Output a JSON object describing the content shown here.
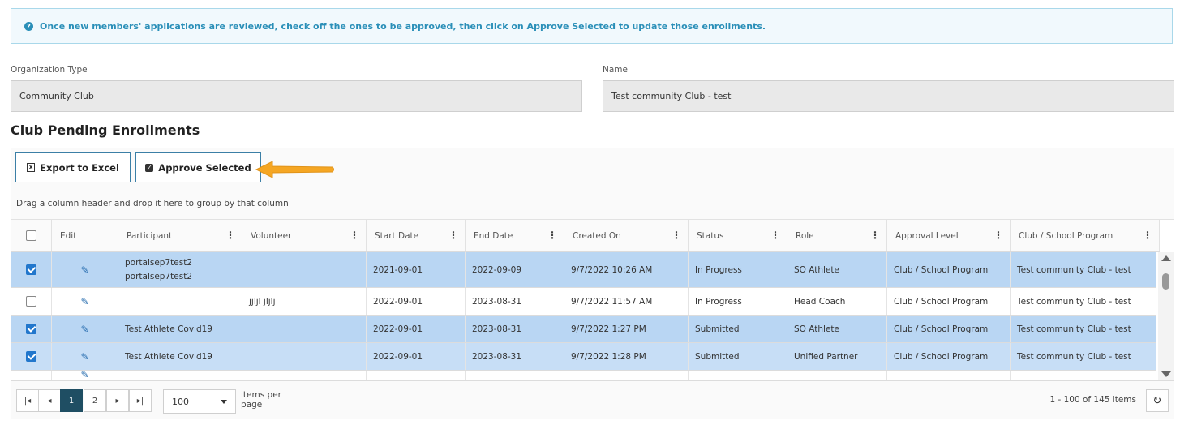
{
  "info": {
    "message": "Once new members' applications are reviewed, check off the ones to be approved, then click on Approve Selected to update those enrollments."
  },
  "fields": {
    "org_type_label": "Organization Type",
    "org_type_value": "Community Club",
    "name_label": "Name",
    "name_value": "Test community Club - test"
  },
  "section_title": "Club Pending Enrollments",
  "toolbar": {
    "export_label": "Export to Excel",
    "approve_label": "Approve Selected"
  },
  "group_hint": "Drag a column header and drop it here to group by that column",
  "columns": [
    "Edit",
    "Participant",
    "Volunteer",
    "Start Date",
    "End Date",
    "Created On",
    "Status",
    "Role",
    "Approval Level",
    "Club / School Program"
  ],
  "rows": [
    {
      "checked": true,
      "participant": "portalsep7test2\nportalsep7test2",
      "volunteer": "",
      "start": "2021-09-01",
      "end": "2022-09-09",
      "created": "9/7/2022 10:26 AM",
      "status": "In Progress",
      "role": "SO Athlete",
      "approval": "Club / School Program",
      "program": "Test community Club - test"
    },
    {
      "checked": false,
      "participant": "",
      "volunteer": "jjljl jljlj",
      "start": "2022-09-01",
      "end": "2023-08-31",
      "created": "9/7/2022 11:57 AM",
      "status": "In Progress",
      "role": "Head Coach",
      "approval": "Club / School Program",
      "program": "Test community Club - test"
    },
    {
      "checked": true,
      "participant": "Test Athlete Covid19",
      "volunteer": "",
      "start": "2022-09-01",
      "end": "2023-08-31",
      "created": "9/7/2022 1:27 PM",
      "status": "Submitted",
      "role": "SO Athlete",
      "approval": "Club / School Program",
      "program": "Test community Club - test"
    },
    {
      "checked": true,
      "participant": "Test Athlete Covid19",
      "volunteer": "",
      "start": "2022-09-01",
      "end": "2023-08-31",
      "created": "9/7/2022 1:28 PM",
      "status": "Submitted",
      "role": "Unified Partner",
      "approval": "Club / School Program",
      "program": "Test community Club - test"
    }
  ],
  "pager": {
    "first_icon": "first-page-icon",
    "prev_icon": "prev-page-icon",
    "next_icon": "next-page-icon",
    "last_icon": "last-page-icon",
    "page1": "1",
    "page2": "2",
    "page_size": "100",
    "items_per_page": "items per page",
    "range": "1 - 100 of 145 items"
  },
  "colors": {
    "accent": "#1f4e63",
    "info_text": "#2a8fb8",
    "selected_row": "#b9d6f3",
    "arrow": "#f5a623"
  }
}
